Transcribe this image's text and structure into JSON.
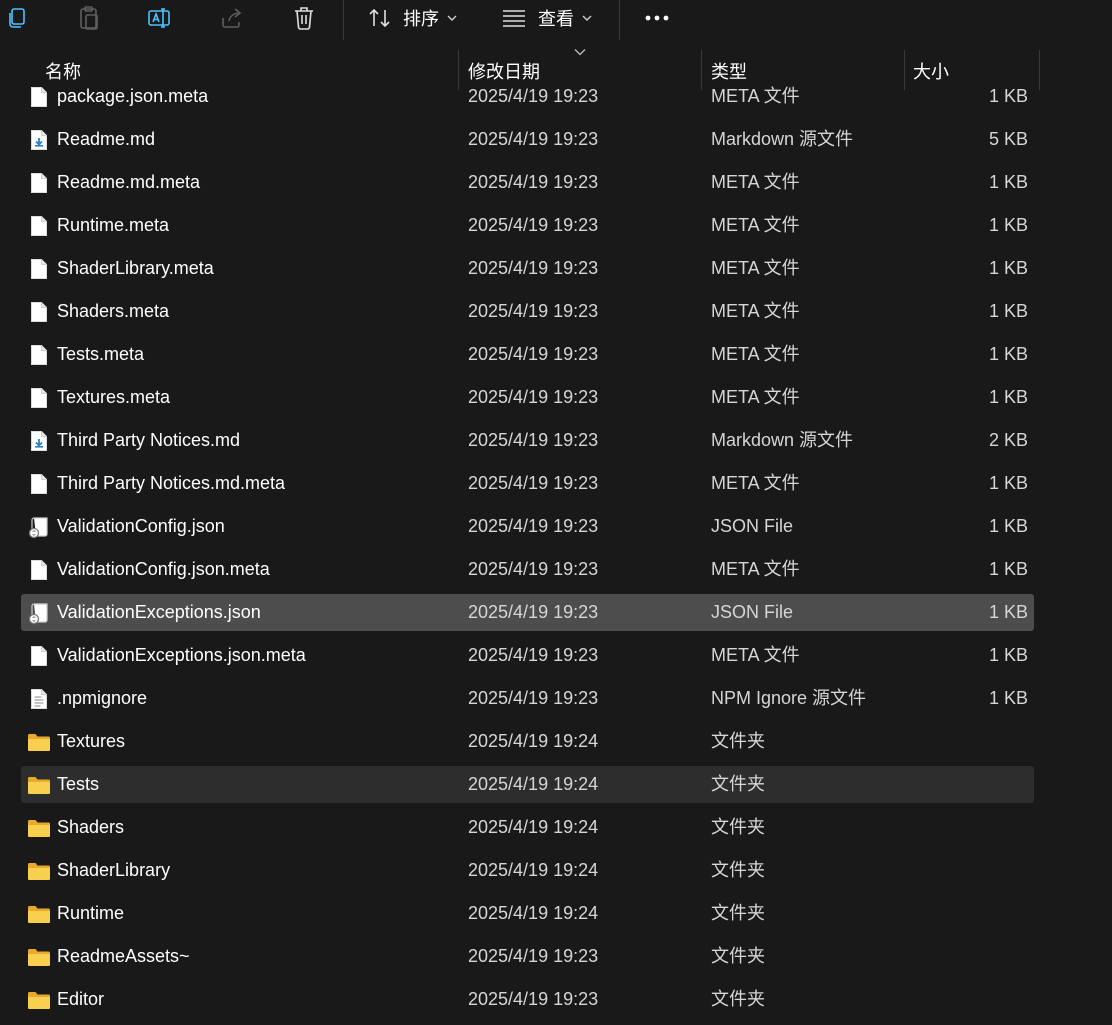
{
  "toolbar": {
    "sort_label": "排序",
    "view_label": "查看",
    "icons": [
      "copy-icon",
      "paste-icon",
      "rename-icon",
      "share-icon",
      "delete-icon",
      "sort-icon",
      "view-icon",
      "more-icon"
    ]
  },
  "columns": {
    "name": "名称",
    "date": "修改日期",
    "type": "类型",
    "size": "大小"
  },
  "files": [
    {
      "name": "package.json.meta",
      "date": "2025/4/19 19:23",
      "type": "META 文件",
      "size": "1 KB",
      "icon": "file-icon",
      "state": ""
    },
    {
      "name": "Readme.md",
      "date": "2025/4/19 19:23",
      "type": "Markdown 源文件",
      "size": "5 KB",
      "icon": "markdown-file-icon",
      "state": ""
    },
    {
      "name": "Readme.md.meta",
      "date": "2025/4/19 19:23",
      "type": "META 文件",
      "size": "1 KB",
      "icon": "file-icon",
      "state": ""
    },
    {
      "name": "Runtime.meta",
      "date": "2025/4/19 19:23",
      "type": "META 文件",
      "size": "1 KB",
      "icon": "file-icon",
      "state": ""
    },
    {
      "name": "ShaderLibrary.meta",
      "date": "2025/4/19 19:23",
      "type": "META 文件",
      "size": "1 KB",
      "icon": "file-icon",
      "state": ""
    },
    {
      "name": "Shaders.meta",
      "date": "2025/4/19 19:23",
      "type": "META 文件",
      "size": "1 KB",
      "icon": "file-icon",
      "state": ""
    },
    {
      "name": "Tests.meta",
      "date": "2025/4/19 19:23",
      "type": "META 文件",
      "size": "1 KB",
      "icon": "file-icon",
      "state": ""
    },
    {
      "name": "Textures.meta",
      "date": "2025/4/19 19:23",
      "type": "META 文件",
      "size": "1 KB",
      "icon": "file-icon",
      "state": ""
    },
    {
      "name": "Third Party Notices.md",
      "date": "2025/4/19 19:23",
      "type": "Markdown 源文件",
      "size": "2 KB",
      "icon": "markdown-file-icon",
      "state": ""
    },
    {
      "name": "Third Party Notices.md.meta",
      "date": "2025/4/19 19:23",
      "type": "META 文件",
      "size": "1 KB",
      "icon": "file-icon",
      "state": ""
    },
    {
      "name": "ValidationConfig.json",
      "date": "2025/4/19 19:23",
      "type": "JSON File",
      "size": "1 KB",
      "icon": "json-file-icon",
      "state": ""
    },
    {
      "name": "ValidationConfig.json.meta",
      "date": "2025/4/19 19:23",
      "type": "META 文件",
      "size": "1 KB",
      "icon": "file-icon",
      "state": ""
    },
    {
      "name": "ValidationExceptions.json",
      "date": "2025/4/19 19:23",
      "type": "JSON File",
      "size": "1 KB",
      "icon": "json-file-icon",
      "state": "selected"
    },
    {
      "name": "ValidationExceptions.json.meta",
      "date": "2025/4/19 19:23",
      "type": "META 文件",
      "size": "1 KB",
      "icon": "file-icon",
      "state": ""
    },
    {
      "name": ".npmignore",
      "date": "2025/4/19 19:23",
      "type": "NPM Ignore 源文件",
      "size": "1 KB",
      "icon": "text-file-icon",
      "state": ""
    },
    {
      "name": "Textures",
      "date": "2025/4/19 19:24",
      "type": "文件夹",
      "size": "",
      "icon": "folder-icon",
      "state": ""
    },
    {
      "name": "Tests",
      "date": "2025/4/19 19:24",
      "type": "文件夹",
      "size": "",
      "icon": "folder-icon",
      "state": "hover"
    },
    {
      "name": "Shaders",
      "date": "2025/4/19 19:24",
      "type": "文件夹",
      "size": "",
      "icon": "folder-icon",
      "state": ""
    },
    {
      "name": "ShaderLibrary",
      "date": "2025/4/19 19:24",
      "type": "文件夹",
      "size": "",
      "icon": "folder-icon",
      "state": ""
    },
    {
      "name": "Runtime",
      "date": "2025/4/19 19:24",
      "type": "文件夹",
      "size": "",
      "icon": "folder-icon",
      "state": ""
    },
    {
      "name": "ReadmeAssets~",
      "date": "2025/4/19 19:23",
      "type": "文件夹",
      "size": "",
      "icon": "folder-icon",
      "state": ""
    },
    {
      "name": "Editor",
      "date": "2025/4/19 19:23",
      "type": "文件夹",
      "size": "",
      "icon": "folder-icon",
      "state": ""
    }
  ],
  "colors": {
    "background": "#191919",
    "selected_row": "#4d4d4d",
    "hover_row": "#2d2d2d",
    "folder": "#f4c542",
    "accent": "#4cc2ff"
  }
}
